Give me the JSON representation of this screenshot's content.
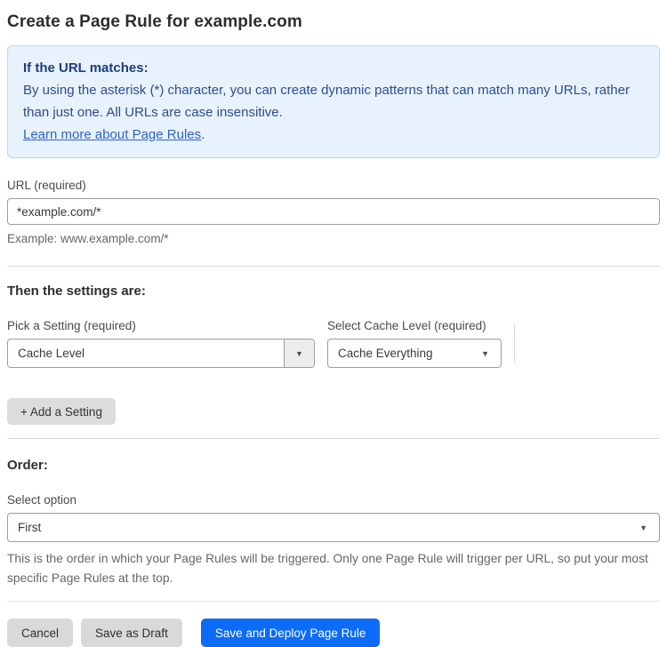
{
  "page": {
    "title": "Create a Page Rule for example.com"
  },
  "info_box": {
    "heading": "If the URL matches:",
    "body": "By using the asterisk (*) character, you can create dynamic patterns that can match many URLs, rather than just one. All URLs are case insensitive.",
    "link": "Learn more about Page Rules",
    "link_suffix": "."
  },
  "url_field": {
    "label": "URL (required)",
    "value": "*example.com/*",
    "example": "Example: www.example.com/*"
  },
  "settings": {
    "heading": "Then the settings are:",
    "pick_setting": {
      "label": "Pick a Setting (required)",
      "selected": "Cache Level"
    },
    "cache_level": {
      "label": "Select Cache Level (required)",
      "selected": "Cache Everything"
    },
    "add_button_label": "+ Add a Setting"
  },
  "order": {
    "heading": "Order:",
    "label": "Select option",
    "selected": "First",
    "help": "This is the order in which your Page Rules will be triggered. Only one Page Rule will trigger per URL, so put your most specific Page Rules at the top."
  },
  "footer": {
    "cancel_label": "Cancel",
    "save_draft_label": "Save as Draft",
    "save_deploy_label": "Save and Deploy Page Rule"
  },
  "icons": {
    "dropdown_arrow": "▼"
  },
  "colors": {
    "primary_button": "#0b6cfa",
    "info_background": "#e8f2fc",
    "info_border": "#b9d7f3",
    "info_text": "#2c4d94",
    "link": "#2d63ca",
    "gray_button": "#d9d9d9"
  }
}
